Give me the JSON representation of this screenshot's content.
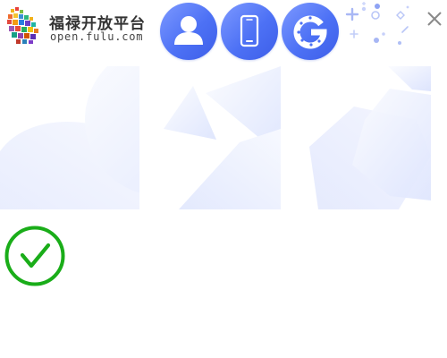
{
  "brand": {
    "name": "福禄开放平台",
    "domain": "open.fulu.com"
  },
  "header": {
    "login_options": [
      {
        "name": "account",
        "icon": "user-icon"
      },
      {
        "name": "phone",
        "icon": "mobile-phone-icon"
      },
      {
        "name": "google",
        "icon": "google-icon"
      }
    ],
    "close_icon": "close-icon"
  },
  "captcha": {
    "tiles": 3,
    "status_icon": "checkmark-circle-icon"
  },
  "colors": {
    "accent_blue": "#4d71f5",
    "success_green": "#1aad19",
    "brand_text": "#333333"
  }
}
